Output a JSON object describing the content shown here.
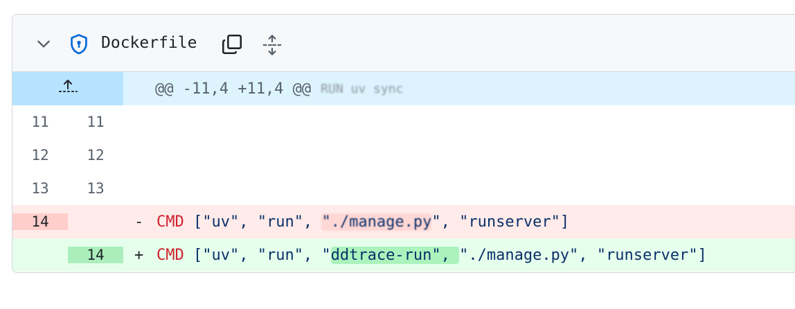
{
  "file": {
    "name": "Dockerfile",
    "icons": {
      "collapse": "chevron-down-icon",
      "security": "shield-icon",
      "copy": "copy-icon",
      "expand": "unfold-icon"
    },
    "accent": "#0969da"
  },
  "hunk": {
    "header": "@@ -11,4 +11,4 @@",
    "context_label": "RUN uv sync",
    "expand_icon": "expand-up-icon"
  },
  "lines": {
    "ctx1": {
      "old": "11",
      "new": "11",
      "text": ""
    },
    "ctx2": {
      "old": "12",
      "new": "12",
      "text": ""
    },
    "ctx3": {
      "old": "13",
      "new": "13",
      "text": ""
    },
    "del": {
      "old": "14",
      "new": "",
      "sign": "-",
      "kw": "CMD",
      "p1": " [\"uv\", \"run\", ",
      "changed": "\"./manage.py",
      "p2": "\", \"runserver\"]"
    },
    "add": {
      "old": "",
      "new": "14",
      "sign": "+",
      "kw": "CMD",
      "p1": " [\"uv\", \"run\", \"",
      "changed": "ddtrace-run\", ",
      "p2": "\"./manage.py\", \"runserver\"]"
    }
  },
  "colors": {
    "deletion_bg": "#ffebe9",
    "addition_bg": "#e6ffec",
    "hunk_bg": "#ddf4ff"
  }
}
